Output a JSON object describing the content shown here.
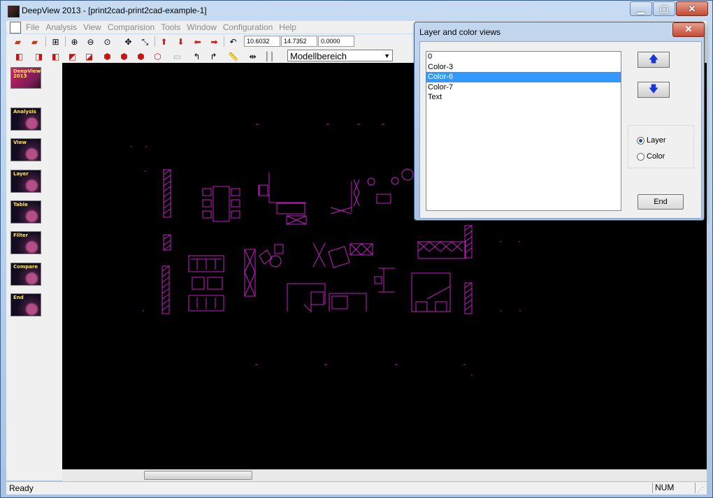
{
  "window": {
    "title": "DeepView 2013 - [print2cad-print2cad-example-1]",
    "min_label": "▁",
    "max_label": "▢",
    "close_label": "✕"
  },
  "menu": {
    "items": [
      "File",
      "Analysis",
      "View",
      "Comparision",
      "Tools",
      "Window",
      "Configuration",
      "Help"
    ]
  },
  "toolbar": {
    "coord_x": "10.6032",
    "coord_y": "14.7352",
    "coord_z": "0.0000",
    "space_select": "Modellbereich"
  },
  "sidebar": {
    "logo_label": "DeepView 2013",
    "items": [
      "Analysis",
      "View",
      "Layer",
      "Table",
      "Filter",
      "Compare",
      "End"
    ]
  },
  "dialog": {
    "title": "Layer and color views",
    "close_label": "✕",
    "list_items": [
      "0",
      "Color-3",
      "Color-6",
      "Color-7",
      "Text"
    ],
    "selected_index": 2,
    "up_label": "🡅",
    "down_label": "🡇",
    "radio_layer": "Layer",
    "radio_color": "Color",
    "radio_selected": "Layer",
    "end_label": "End"
  },
  "status": {
    "text": "Ready",
    "num": "NUM"
  },
  "colors": {
    "drawing": "#c51ec5",
    "canvas_bg": "#000000",
    "selection": "#3399ff"
  }
}
